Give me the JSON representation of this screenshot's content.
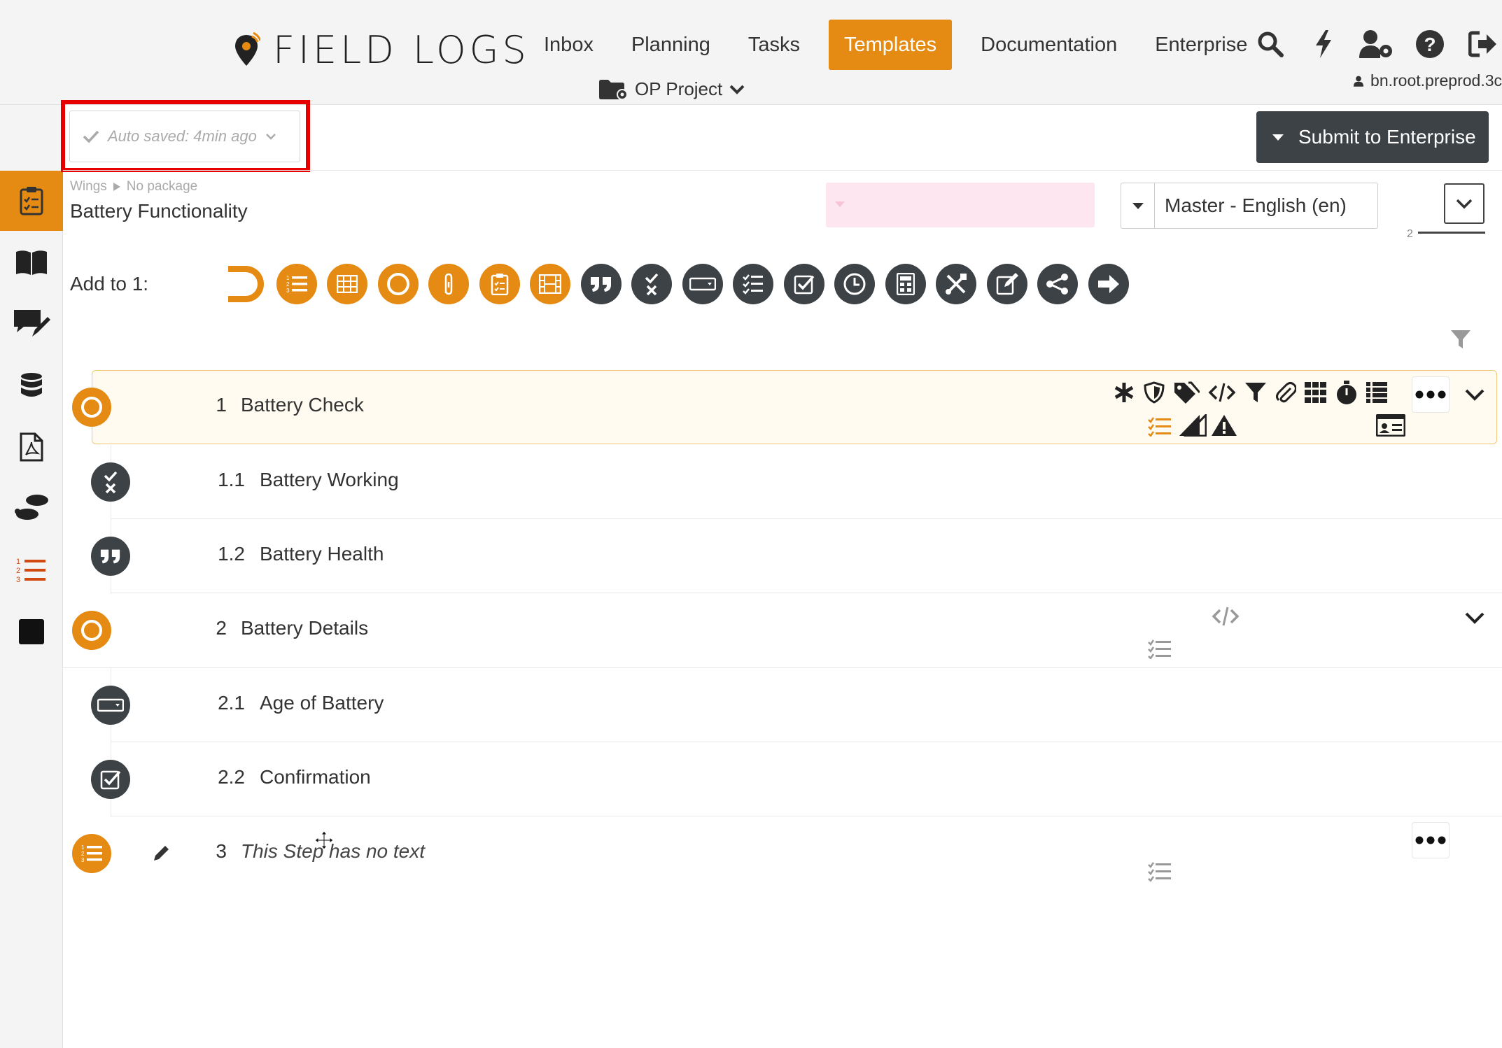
{
  "brand": {
    "name": "FIELD LOGS",
    "accent": "#e58a12",
    "dark": "#3d4246"
  },
  "nav": {
    "items": [
      "Inbox",
      "Planning",
      "Tasks",
      "Templates",
      "Documentation",
      "Enterprise"
    ],
    "active": "Templates"
  },
  "header_icons": [
    "search-icon",
    "bolt-icon",
    "user-gear-icon",
    "help-icon",
    "logout-icon"
  ],
  "project": {
    "label": "OP Project"
  },
  "user": {
    "name": "bn.root.preprod.3c"
  },
  "sidebar": [
    "checklist-icon",
    "book-icon",
    "comments-edit-icon",
    "database-icon",
    "pdf-icon",
    "footsteps-icon",
    "numbered-list-icon",
    "square-icon"
  ],
  "toolbar": {
    "autosave_label": "Auto saved: 4min ago",
    "submit_label": "Submit to Enterprise"
  },
  "breadcrumb": {
    "root": "Wings",
    "package": "No package"
  },
  "doc_title": "Battery Functionality",
  "language": {
    "selected": "Master - English (en)"
  },
  "outline_indicator": "2",
  "add_to": {
    "label": "Add to 1:",
    "buttons": [
      "partial-circle-icon",
      "numbered-list-icon",
      "table-icon",
      "circle-icon",
      "clip-icon",
      "clipboard-icon",
      "film-icon",
      "quote-icon",
      "check-cross-icon",
      "input-box-icon",
      "checklist-icon",
      "checkbox-icon",
      "clock-icon",
      "calculator-icon",
      "tools-icon",
      "edit-icon",
      "share-icon",
      "arrow-right-icon"
    ]
  },
  "steps": [
    {
      "num": "1",
      "text": "Battery Check",
      "icon": "circle-icon",
      "level": 0,
      "selected": true
    },
    {
      "num": "1.1",
      "text": "Battery Working",
      "icon": "check-cross-icon",
      "level": 1
    },
    {
      "num": "1.2",
      "text": "Battery Health",
      "icon": "quote-icon",
      "level": 1
    },
    {
      "num": "2",
      "text": "Battery Details",
      "icon": "circle-icon",
      "level": 0
    },
    {
      "num": "2.1",
      "text": "Age of Battery",
      "icon": "input-box-icon",
      "level": 1
    },
    {
      "num": "2.2",
      "text": "Confirmation",
      "icon": "checkbox-icon",
      "level": 1
    },
    {
      "num": "3",
      "text": "This Step has no text",
      "icon": "numbered-list-icon",
      "level": 0,
      "placeholder": true
    }
  ],
  "step_property_icons": [
    "asterisk-icon",
    "shield-icon",
    "tags-icon",
    "code-icon",
    "filter-icon",
    "paperclip-icon",
    "grid-icon",
    "stopwatch-icon",
    "stack-icon"
  ]
}
